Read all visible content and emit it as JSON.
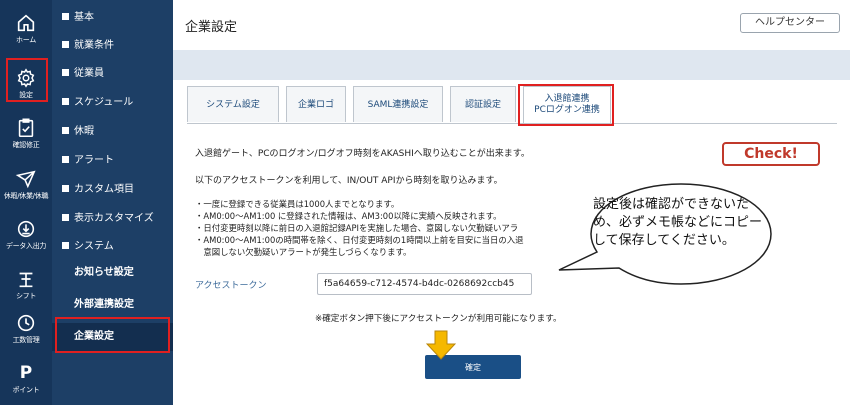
{
  "rail": [
    {
      "label": "ホーム",
      "icon": "home-icon"
    },
    {
      "label": "設定",
      "icon": "gear-icon"
    },
    {
      "label": "確認修正",
      "icon": "clipboard-check-icon"
    },
    {
      "label": "休暇/休業/休職",
      "icon": "plane-icon"
    },
    {
      "label": "データ入出力",
      "icon": "import-export-icon"
    },
    {
      "label": "シフト",
      "icon": "shift-icon"
    },
    {
      "label": "工数管理",
      "icon": "clock-icon"
    },
    {
      "label": "ポイント",
      "icon": "point-icon"
    }
  ],
  "rail_point_glyph": "P",
  "menu": {
    "items": [
      "基本",
      "就業条件",
      "従業員",
      "スケジュール",
      "休暇",
      "アラート",
      "カスタム項目",
      "表示カスタマイズ",
      "システム"
    ],
    "subitems": [
      "お知らせ設定",
      "外部連携設定",
      "企業設定"
    ]
  },
  "header": {
    "title": "企業設定",
    "help_label": "ヘルプセンター"
  },
  "tabs": [
    {
      "label": "システム設定"
    },
    {
      "label": "企業ロゴ"
    },
    {
      "label": "SAML連携設定"
    },
    {
      "label": "認証設定"
    },
    {
      "label_line1": "入退館連携",
      "label_line2": "PCログオン連携"
    }
  ],
  "content": {
    "intro": "入退館ゲート、PCのログオン/ログオフ時刻をAKASHIへ取り込むことが出来ます。",
    "intro2": "以下のアクセストークンを利用して、IN/OUT APIから時刻を取り込みます。",
    "bullets": [
      "・一度に登録できる従業員は1000人までとなります。",
      "・AM0:00〜AM1:00 に登録された情報は、AM3:00以降に実績へ反映されます。",
      "・日付変更時刻以降に前日の入退館記録APIを実施した場合、意図しない欠勤疑いアラ",
      "・AM0:00〜AM1:00の時間帯を除く、日付変更時刻の1時間以上前を目安に当日の入退",
      "　意図しない欠勤疑いアラートが発生しづらくなります。"
    ],
    "token_label": "アクセストークン",
    "token_value": "f5a64659-c712-4574-b4dc-0268692ccb45",
    "token_note": "※確定ボタン押下後にアクセストークンが利用可能になります。",
    "confirm_label": "確定"
  },
  "annotation": {
    "check_label": "Check!",
    "bubble_text": "設定後は確認ができないため、必ずメモ帳などにコピーして保存してください。",
    "frame_color": "#e02020",
    "arrow_color": "#f5b800"
  },
  "colors": {
    "rail_bg": "#16355a",
    "menu_bg": "#1d3f66",
    "accent": "#1a4f86"
  }
}
